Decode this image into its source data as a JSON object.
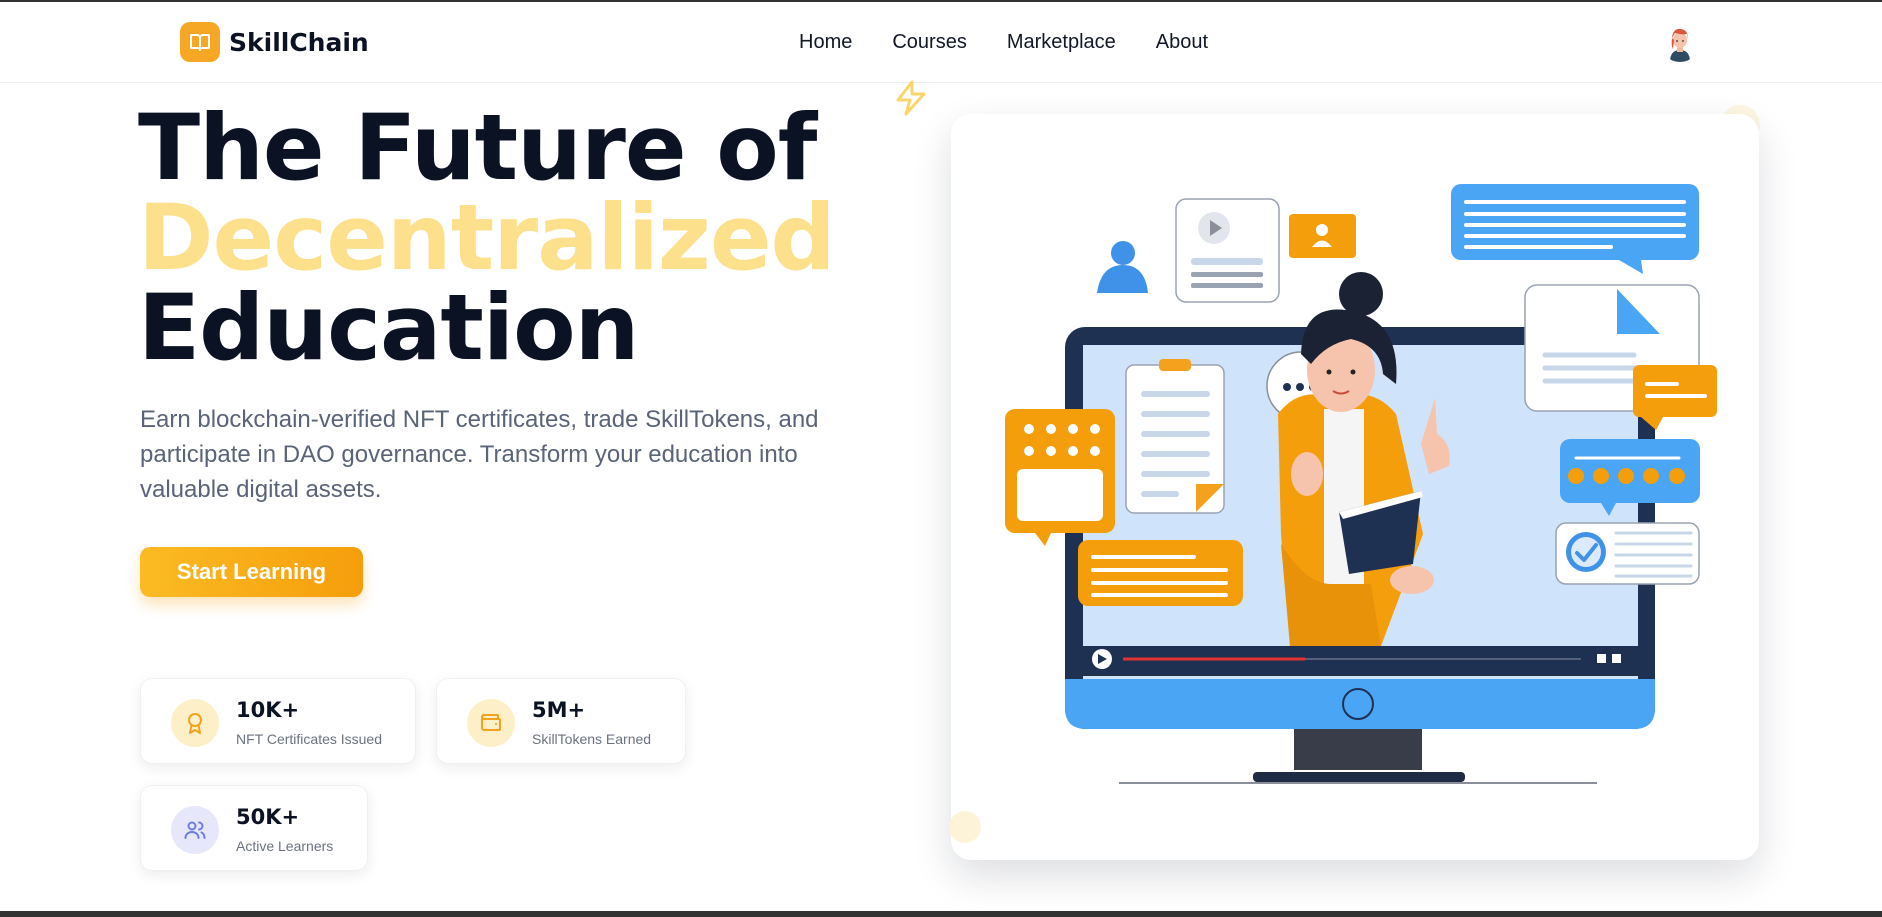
{
  "brand": {
    "name": "SkillChain",
    "logo_icon": "open-book-icon",
    "accent": "#f6a723"
  },
  "nav": {
    "items": [
      "Home",
      "Courses",
      "Marketplace",
      "About"
    ]
  },
  "user": {
    "avatar_icon": "user-avatar"
  },
  "hero": {
    "title_line1": "The Future of",
    "title_line2": "Decentralized",
    "title_line3": "Education",
    "accent_color": "#fde08b",
    "description": "Earn blockchain-verified NFT certificates, trade SkillTokens, and participate in DAO governance. Transform your education into valuable digital assets.",
    "cta_label": "Start Learning"
  },
  "stats": [
    {
      "value": "10K+",
      "label": "NFT Certificates Issued",
      "icon": "award-icon",
      "icon_bg": "#fdf0c9"
    },
    {
      "value": "5M+",
      "label": "SkillTokens Earned",
      "icon": "wallet-icon",
      "icon_bg": "#fdf0c9"
    },
    {
      "value": "50K+",
      "label": "Active Learners",
      "icon": "users-icon",
      "icon_bg": "#e7e7fb"
    }
  ],
  "illustration": {
    "subject": "online-teacher-illustration"
  }
}
